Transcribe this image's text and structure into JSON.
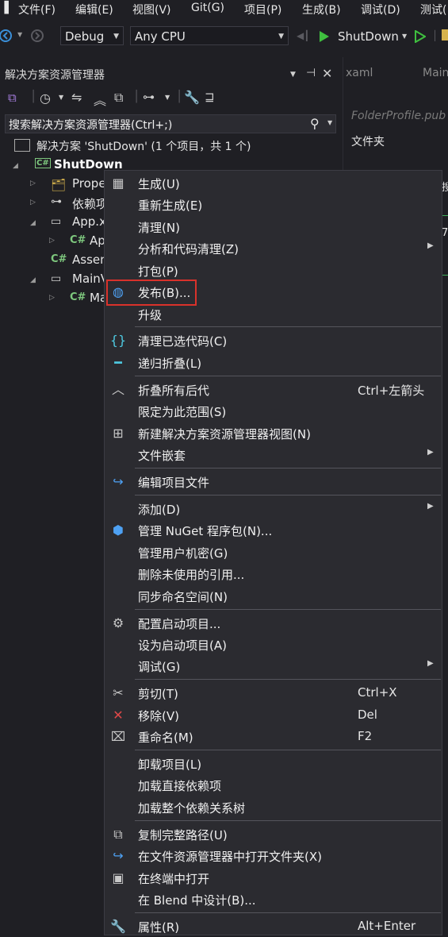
{
  "menubar": {
    "items": [
      "文件(F)",
      "编辑(E)",
      "视图(V)",
      "Git(G)",
      "项目(P)",
      "生成(B)",
      "调试(D)",
      "测试("
    ]
  },
  "toolbar": {
    "config": "Debug",
    "platform": "Any CPU",
    "run_target": "ShutDown"
  },
  "explorer": {
    "title": "解决方案资源管理器",
    "search_placeholder": "搜索解决方案资源管理器(Ctrl+;)",
    "solution_label": "解决方案 'ShutDown' (1 个项目，共 1 个)",
    "project": "ShutDown",
    "items": [
      "Prope",
      "依赖项",
      "App.x",
      "Ap",
      "Assen",
      "MainV",
      "Ma"
    ]
  },
  "doc_panel": {
    "tab1": "xaml",
    "tab2": "Main",
    "file": "FolderProfile.pub",
    "folder_label": "文件夹"
  },
  "context_menu": {
    "items": [
      {
        "label": "生成(U)",
        "icon": "build-icon"
      },
      {
        "label": "重新生成(E)"
      },
      {
        "label": "清理(N)"
      },
      {
        "label": "分析和代码清理(Z)",
        "submenu": true
      },
      {
        "label": "打包(P)"
      },
      {
        "label": "发布(B)...",
        "icon": "globe-icon",
        "highlighted": true
      },
      {
        "label": "升级"
      },
      {
        "label": "清理已选代码(C)",
        "icon": "braces-icon"
      },
      {
        "label": "递归折叠(L)",
        "icon": "minus-icon"
      },
      {
        "label": "折叠所有后代",
        "shortcut": "Ctrl+左箭头",
        "icon": "chevron-up-icon"
      },
      {
        "label": "限定为此范围(S)"
      },
      {
        "label": "新建解决方案资源管理器视图(N)",
        "icon": "new-view-icon"
      },
      {
        "label": "文件嵌套",
        "submenu": true
      },
      {
        "label": "编辑项目文件",
        "icon": "redo-arrow-icon"
      },
      {
        "label": "添加(D)",
        "submenu": true
      },
      {
        "label": "管理 NuGet 程序包(N)...",
        "icon": "nuget-icon"
      },
      {
        "label": "管理用户机密(G)"
      },
      {
        "label": "删除未使用的引用..."
      },
      {
        "label": "同步命名空间(N)"
      },
      {
        "label": "配置启动项目...",
        "icon": "gear-icon"
      },
      {
        "label": "设为启动项目(A)"
      },
      {
        "label": "调试(G)",
        "submenu": true
      },
      {
        "label": "剪切(T)",
        "shortcut": "Ctrl+X",
        "icon": "scissors-icon"
      },
      {
        "label": "移除(V)",
        "shortcut": "Del",
        "icon": "remove-x-icon"
      },
      {
        "label": "重命名(M)",
        "shortcut": "F2",
        "icon": "rename-icon"
      },
      {
        "label": "卸载项目(L)"
      },
      {
        "label": "加载直接依赖项"
      },
      {
        "label": "加载整个依赖关系树"
      },
      {
        "label": "复制完整路径(U)",
        "icon": "copy-icon"
      },
      {
        "label": "在文件资源管理器中打开文件夹(X)",
        "icon": "open-folder-arrow-icon"
      },
      {
        "label": "在终端中打开",
        "icon": "terminal-icon"
      },
      {
        "label": "在 Blend 中设计(B)..."
      },
      {
        "label": "属性(R)",
        "shortcut": "Alt+Enter",
        "icon": "wrench-icon"
      }
    ],
    "submenu_glyph": "▶"
  },
  "colors": {
    "background": "#1f1f24",
    "menu_bg": "#2b2b30",
    "highlight_border": "#d9322b",
    "run_green": "#3fbf3f"
  }
}
